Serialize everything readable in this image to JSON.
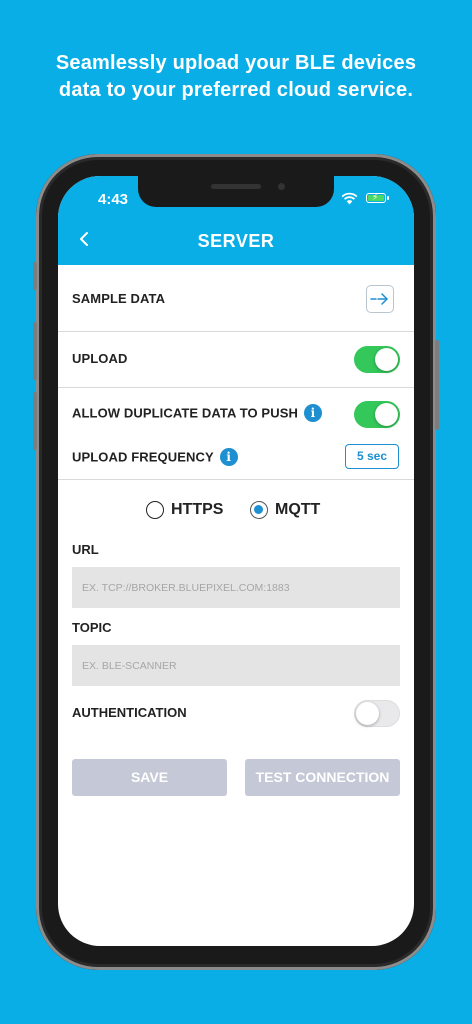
{
  "headline": {
    "line1": "Seamlessly upload your BLE devices",
    "line2": "data to your preferred cloud service."
  },
  "status_bar": {
    "time": "4:43",
    "wifi_icon": "wifi-icon",
    "battery_icon": "battery-charging-icon"
  },
  "header": {
    "title": "SERVER",
    "back_icon": "chevron-left-icon"
  },
  "settings": {
    "sample_data": {
      "label": "SAMPLE DATA",
      "icon": "arrow-right-icon"
    },
    "upload": {
      "label": "UPLOAD",
      "enabled": true
    },
    "allow_duplicate": {
      "label": "ALLOW DUPLICATE DATA TO PUSH",
      "enabled": true,
      "info_icon": "info-icon"
    },
    "upload_frequency": {
      "label": "UPLOAD FREQUENCY",
      "value": "5 sec",
      "info_icon": "info-icon"
    }
  },
  "protocol": {
    "options": [
      {
        "label": "HTTPS",
        "selected": false
      },
      {
        "label": "MQTT",
        "selected": true
      }
    ]
  },
  "form": {
    "url": {
      "label": "URL",
      "value": "",
      "placeholder": "EX. TCP://BROKER.BLUEPIXEL.COM:1883"
    },
    "topic": {
      "label": "TOPIC",
      "value": "",
      "placeholder": "EX. BLE-SCANNER"
    },
    "authentication": {
      "label": "AUTHENTICATION",
      "enabled": false
    }
  },
  "actions": {
    "save_label": "SAVE",
    "test_label": "TEST CONNECTION"
  },
  "colors": {
    "background": "#0aaee6",
    "accent": "#1e8fd0",
    "toggle_on": "#34c759",
    "button_disabled": "#c5c8d6"
  }
}
